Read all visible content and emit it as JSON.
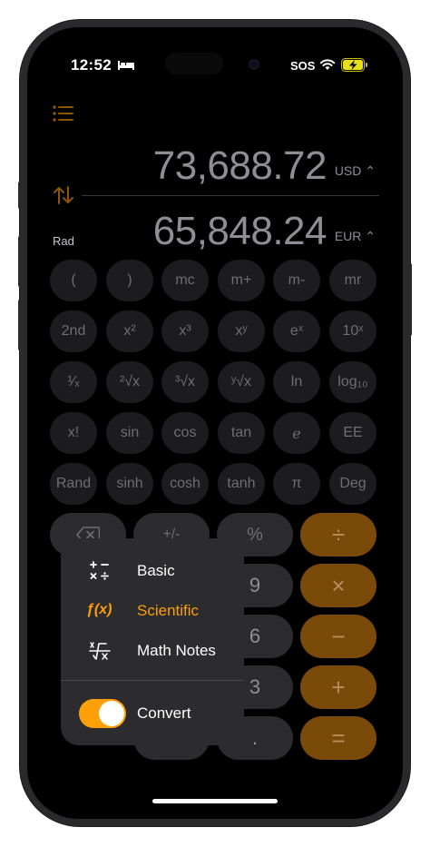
{
  "status_bar": {
    "time": "12:52",
    "sos": "SOS",
    "icons": [
      "bed-icon",
      "wifi-icon",
      "battery-charging-icon"
    ]
  },
  "display": {
    "mode_label": "Rad",
    "top_value": "73,688.72",
    "top_currency": "USD",
    "bottom_value": "65,848.24",
    "bottom_currency": "EUR"
  },
  "keypad": {
    "rows": [
      [
        "(",
        ")",
        "mc",
        "m+",
        "m-",
        "mr"
      ],
      [
        "2nd",
        "x²",
        "x³",
        "xʸ",
        "eˣ",
        "10ˣ"
      ],
      [
        "¹⁄ₓ",
        "²√x",
        "³√x",
        "ʸ√x",
        "ln",
        "log₁₀"
      ],
      [
        "x!",
        "sin",
        "cos",
        "tan",
        "e",
        "EE"
      ],
      [
        "Rand",
        "sinh",
        "cosh",
        "tanh",
        "π",
        "Deg"
      ]
    ],
    "func_row": [
      "⌫",
      "+/-",
      "%",
      "÷"
    ],
    "num_keys": [
      "9",
      "6",
      "3",
      "."
    ],
    "operators": [
      "×",
      "−",
      "+",
      "="
    ]
  },
  "mode_menu": {
    "items": [
      {
        "label": "Basic",
        "icon": "basic-operators-icon"
      },
      {
        "label": "Scientific",
        "icon": "function-fx-icon",
        "active": true
      },
      {
        "label": "Math Notes",
        "icon": "math-notes-icon"
      }
    ],
    "toggle_label": "Convert",
    "toggle_on": true
  },
  "colors": {
    "accent": "#ff9f0a",
    "background": "#000000",
    "key": "#1c1c1e",
    "operator_dim": "#7a4b08"
  }
}
